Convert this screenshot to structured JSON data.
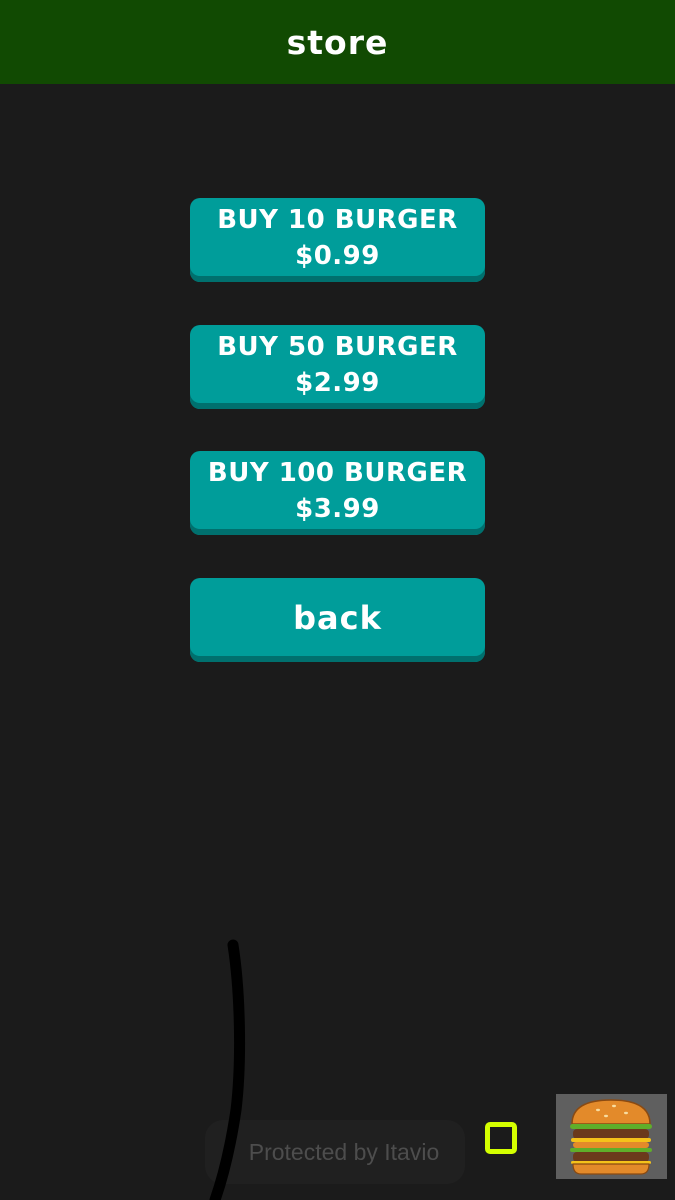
{
  "header": {
    "title": "store"
  },
  "store": {
    "items": [
      {
        "label": "BUY 10 BURGER",
        "price": "$0.99"
      },
      {
        "label": "BUY 50 BURGER",
        "price": "$2.99"
      },
      {
        "label": "BUY 100 BURGER",
        "price": "$3.99"
      }
    ],
    "back_label": "back"
  },
  "footer": {
    "protected_text": "Protected by Itavio",
    "square_icon": "square-outline-icon",
    "burger_icon": "burger-icon"
  },
  "colors": {
    "header_bg": "#114a02",
    "page_bg": "#1b1b1b",
    "button_bg": "#009d9a",
    "button_shadow": "#00706e",
    "accent_square": "#d4ff00"
  }
}
